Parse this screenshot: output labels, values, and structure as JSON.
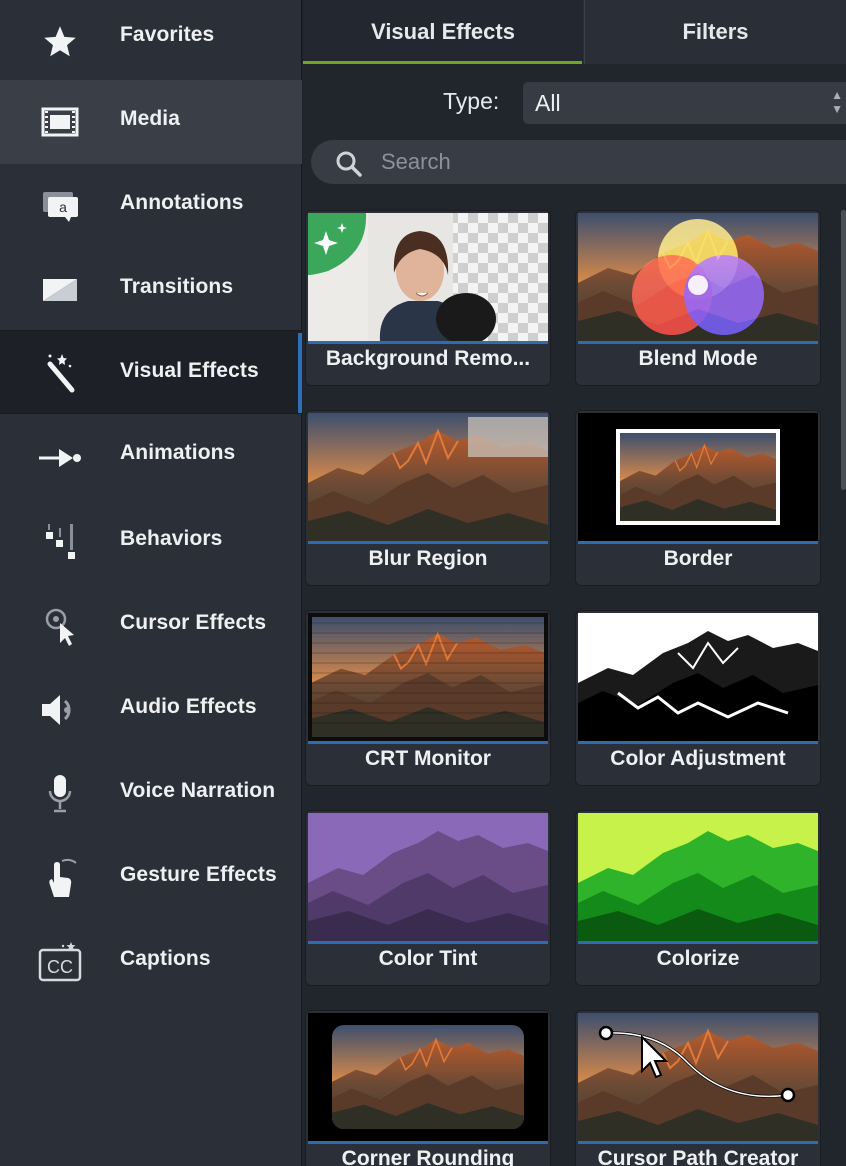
{
  "sidebar": {
    "items": [
      {
        "label": "Favorites",
        "icon": "star-icon"
      },
      {
        "label": "Media",
        "icon": "film-icon"
      },
      {
        "label": "Annotations",
        "icon": "annotation-icon"
      },
      {
        "label": "Transitions",
        "icon": "transition-icon"
      },
      {
        "label": "Visual Effects",
        "icon": "magic-wand-icon"
      },
      {
        "label": "Animations",
        "icon": "animation-arrow-icon"
      },
      {
        "label": "Behaviors",
        "icon": "behaviors-icon"
      },
      {
        "label": "Cursor Effects",
        "icon": "cursor-icon"
      },
      {
        "label": "Audio Effects",
        "icon": "speaker-icon"
      },
      {
        "label": "Voice Narration",
        "icon": "microphone-icon"
      },
      {
        "label": "Gesture Effects",
        "icon": "hand-gesture-icon"
      },
      {
        "label": "Captions",
        "icon": "cc-icon"
      }
    ]
  },
  "tabs": [
    {
      "label": "Visual Effects"
    },
    {
      "label": "Filters"
    }
  ],
  "filter": {
    "type_label": "Type:",
    "type_value": "All"
  },
  "search": {
    "placeholder": "Search"
  },
  "effects": [
    {
      "label": "Background Remo..."
    },
    {
      "label": "Blend Mode"
    },
    {
      "label": "Blur Region"
    },
    {
      "label": "Border"
    },
    {
      "label": "CRT Monitor"
    },
    {
      "label": "Color Adjustment"
    },
    {
      "label": "Color Tint"
    },
    {
      "label": "Colorize"
    },
    {
      "label": "Corner Rounding"
    },
    {
      "label": "Cursor Path Creator"
    }
  ],
  "colors": {
    "accent_tab": "#6fa820",
    "selection": "#2e6fb8"
  }
}
